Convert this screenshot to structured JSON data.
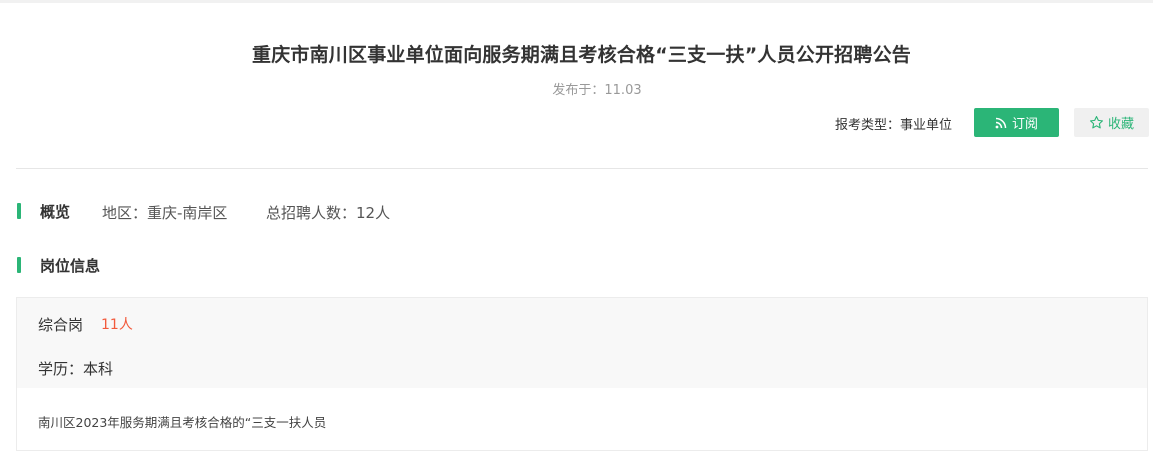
{
  "header": {
    "title": "重庆市南川区事业单位面向服务期满且考核合格“三支一扶”人员公开招聘公告",
    "published": "发布于：11.03",
    "exam_type": "报考类型：事业单位",
    "subscribe_label": "订阅",
    "collect_label": "收藏"
  },
  "overview": {
    "title": "概览",
    "region": "地区：重庆-南岸区",
    "total": "总招聘人数：12人"
  },
  "positions": {
    "title": "岗位信息",
    "items": [
      {
        "name": "综合岗",
        "count": "11人",
        "education": "学历：本科",
        "description": "南川区2023年服务期满且考核合格的“三支一扶人员"
      }
    ]
  },
  "colors": {
    "accent": "#2bb577",
    "count_red": "#f25a3c"
  }
}
